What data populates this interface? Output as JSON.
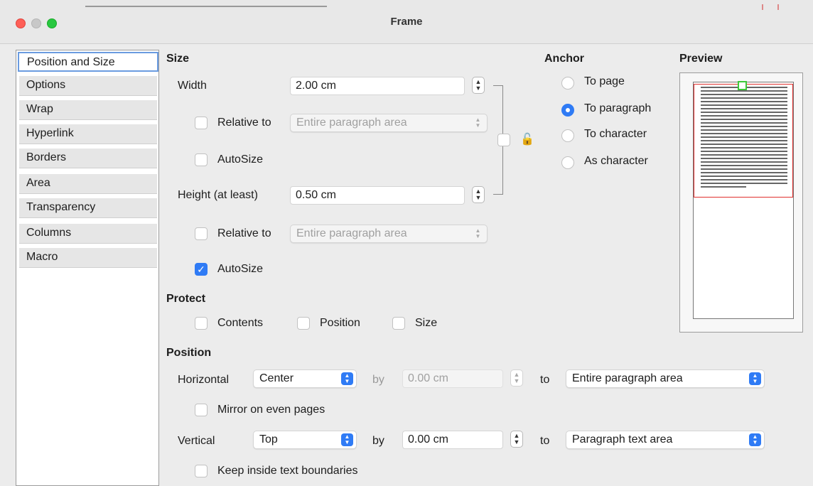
{
  "window": {
    "title": "Frame"
  },
  "sidebar": {
    "items": [
      {
        "label": "Position and Size",
        "active": true
      },
      {
        "label": "Options"
      },
      {
        "label": "Wrap"
      },
      {
        "label": "Hyperlink"
      },
      {
        "label": "Borders"
      },
      {
        "label": "Area"
      },
      {
        "label": "Transparency"
      },
      {
        "label": "Columns"
      },
      {
        "label": "Macro"
      }
    ]
  },
  "size": {
    "heading": "Size",
    "width_label": "Width",
    "width_value": "2.00 cm",
    "width_relative_label": "Relative to",
    "width_relative_value": "Entire paragraph area",
    "width_autosize_label": "AutoSize",
    "height_label": "Height (at least)",
    "height_value": "0.50 cm",
    "height_relative_label": "Relative to",
    "height_relative_value": "Entire paragraph area",
    "height_autosize_label": "AutoSize",
    "height_autosize_checked": true
  },
  "anchor": {
    "heading": "Anchor",
    "options": [
      "To page",
      "To paragraph",
      "To character",
      "As character"
    ],
    "selected": "To paragraph"
  },
  "preview": {
    "heading": "Preview"
  },
  "protect": {
    "heading": "Protect",
    "contents_label": "Contents",
    "position_label": "Position",
    "size_label": "Size"
  },
  "position": {
    "heading": "Position",
    "horizontal_label": "Horizontal",
    "horizontal_value": "Center",
    "h_by_label": "by",
    "h_by_value": "0.00 cm",
    "h_to_label": "to",
    "h_to_value": "Entire paragraph area",
    "mirror_label": "Mirror on even pages",
    "vertical_label": "Vertical",
    "vertical_value": "Top",
    "v_by_label": "by",
    "v_by_value": "0.00 cm",
    "v_to_label": "to",
    "v_to_value": "Paragraph text area",
    "keep_inside_label": "Keep inside text boundaries"
  },
  "colors": {
    "accent": "#2f7bf5",
    "frame_border": "#e0302e",
    "frame_handle": "#3ec93a"
  }
}
